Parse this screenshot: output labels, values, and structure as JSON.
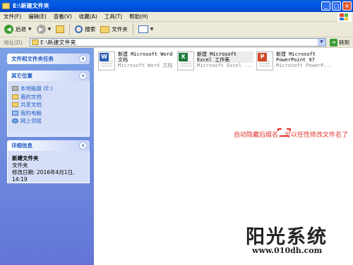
{
  "window": {
    "title": "E:\\新建文件夹",
    "controls": [
      "_",
      "□",
      "×"
    ]
  },
  "menu": {
    "items": [
      "文件(F)",
      "编辑(E)",
      "查看(V)",
      "收藏(A)",
      "工具(T)",
      "帮助(H)"
    ]
  },
  "toolbar": {
    "back_label": "后退",
    "search_label": "搜索",
    "folders_label": "文件夹"
  },
  "address": {
    "label": "地址(D)",
    "value": "E:\\新建文件夹",
    "go_label": "转到"
  },
  "sidebar": {
    "tasks_title": "文件和文件夹任务",
    "places_title": "其它位置",
    "places": [
      "本地磁盘 (E:)",
      "我的文档",
      "共享文档",
      "我的电脑",
      "网上邻居"
    ],
    "details_title": "详细信息",
    "details_name": "新建文件夹",
    "details_type": "文件夹",
    "details_modified_line1": "修改日期: 2016年4月1日,",
    "details_modified_line2": "14:19"
  },
  "files": [
    {
      "name": "新建 Microsoft Word",
      "name2": "文档",
      "type": "Microsoft Word 文档",
      "badge": "W",
      "color": "#2b5eb8"
    },
    {
      "name": "新建 Microsoft",
      "name2": "Excel 工作表",
      "type": "Microsoft Excel ...",
      "badge": "X",
      "color": "#1e7b3c"
    },
    {
      "name": "新建 Microsoft",
      "name2": "PowerPoint 97",
      "type": "Microsoft PowerP...",
      "badge": "P",
      "color": "#d24726"
    }
  ],
  "annotation": "自动隐藏后缀名，可以任性修改文件名了",
  "watermark": {
    "title": "阳光系统",
    "url": "www.010dh.com"
  }
}
